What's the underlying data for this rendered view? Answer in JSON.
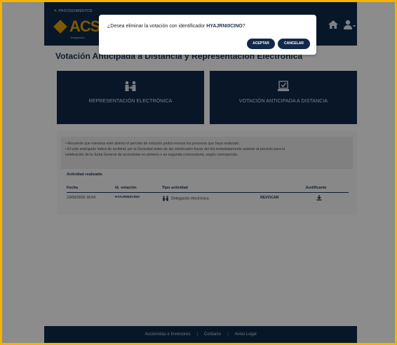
{
  "header": {
    "section_label": "PROCEDIMIENTOS",
    "logo_text": "ACS",
    "logo_sub": "Integración"
  },
  "page": {
    "title": "Votación Anticipada a Distancia y Representación Electrónica"
  },
  "tiles": [
    {
      "label": "REPRESENTACIÓN ELECTRÓNICA",
      "icon": "people-icon"
    },
    {
      "label": "VOTACIÓN ANTICIPADA A DISTANCIA",
      "icon": "ballot-icon"
    }
  ],
  "notice": {
    "lines": [
      "• Recuerde que mientras esté abierto el período de votación podrá revocar los procesos que haya realizado.",
      "• El voto anticipado habrá de recibirse por la Sociedad antes de las veinticuatro horas del día inmediatamente anterior al previsto para la",
      "celebración de la Junta General de accionistas en primera o en segunda convocatoria, según corresponda."
    ]
  },
  "activity": {
    "title": "Actividad realizada:",
    "columns": [
      "Fecha",
      "Id. votación",
      "Tipo actividad",
      "",
      "Justificante"
    ],
    "rows": [
      {
        "fecha": "23/03/2026 18:04",
        "id": "HYAJRNI0CINO",
        "tipo": "Delegación electrónica",
        "accion": "REVOCAR"
      }
    ]
  },
  "footer": {
    "links": [
      "Accionistas e Inversores",
      "Contacto",
      "Aviso Legal"
    ]
  },
  "modal": {
    "message_prefix": "¿Desea eliminar la votación con identificador ",
    "identifier": "HYAJRNI0CINO",
    "message_suffix": "?",
    "accept_label": "ACEPTAR",
    "cancel_label": "CANCELAR"
  },
  "colors": {
    "navy": "#12294a",
    "accent": "#e8a200",
    "frame": "#f4b400"
  }
}
